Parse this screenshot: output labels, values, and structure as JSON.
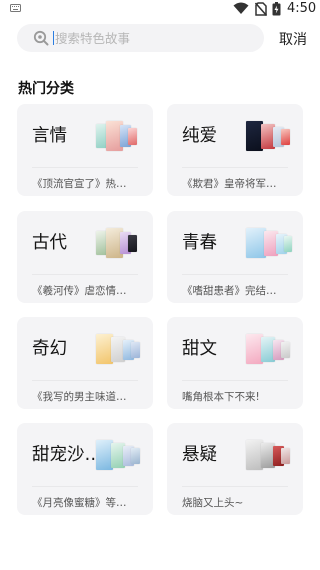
{
  "status": {
    "time": "4:50"
  },
  "search": {
    "placeholder": "搜索特色故事",
    "value": ""
  },
  "cancel_label": "取消",
  "section_title": "热门分类",
  "categories": [
    {
      "name": "言情",
      "desc": "《顶流官宣了》热…"
    },
    {
      "name": "纯爱",
      "desc": "《欺君》皇帝将军…"
    },
    {
      "name": "古代",
      "desc": "《羲河传》虐恋情…"
    },
    {
      "name": "青春",
      "desc": "《嗜甜患者》完结…"
    },
    {
      "name": "奇幻",
      "desc": "《我写的男主味道…"
    },
    {
      "name": "甜文",
      "desc": "嘴角根本下不来!"
    },
    {
      "name": "甜宠沙…",
      "desc": "《月亮像蜜糖》等…"
    },
    {
      "name": "悬疑",
      "desc": "烧脑又上头~"
    }
  ]
}
